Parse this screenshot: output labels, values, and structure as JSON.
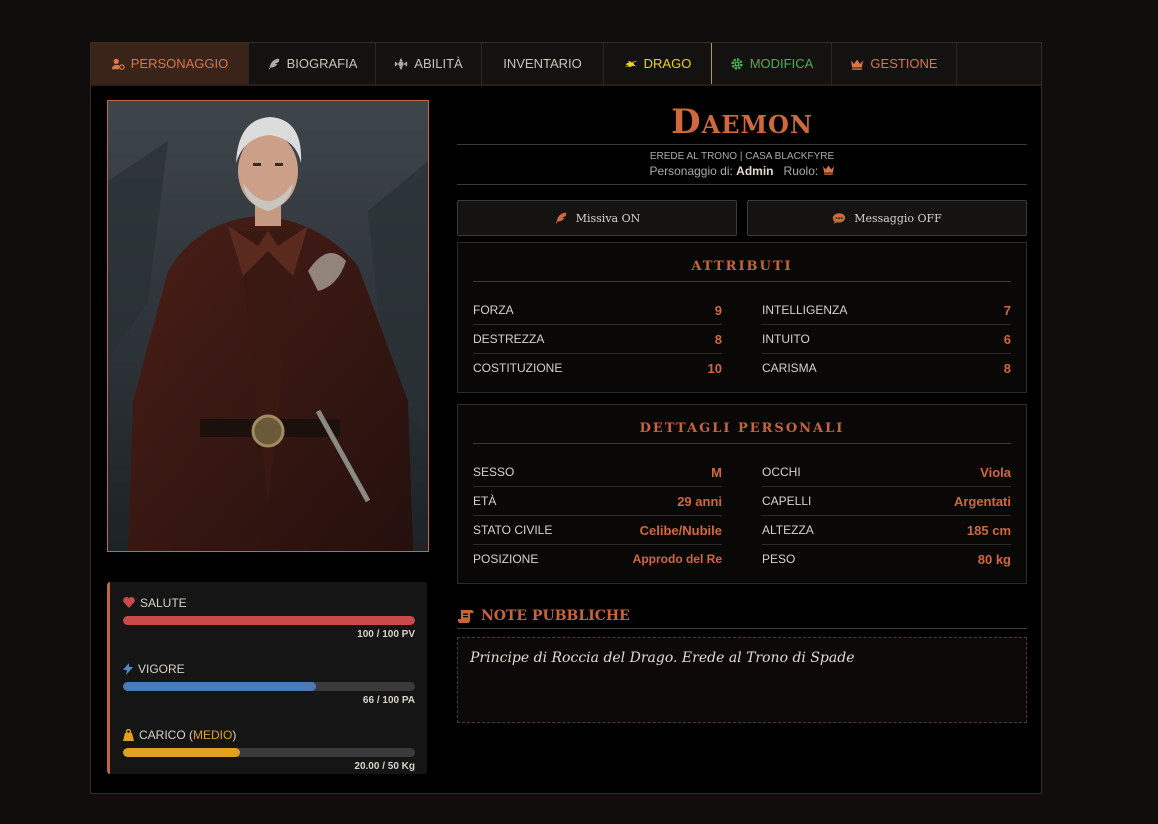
{
  "tabs": [
    {
      "label": "PERSONAGGIO",
      "icon": "user-gear-icon",
      "color": "#d7764a"
    },
    {
      "label": "BIOGRAFIA",
      "icon": "feather-icon",
      "color": "#c8c2b8"
    },
    {
      "label": "ABILITÀ",
      "icon": "emblem-icon",
      "color": "#c8c2b8"
    },
    {
      "label": "INVENTARIO",
      "icon": "",
      "color": "#c8c2b8"
    },
    {
      "label": "DRAGO",
      "icon": "dragon-icon",
      "color": "#f0d020"
    },
    {
      "label": "MODIFICA",
      "icon": "gear-icon",
      "color": "#4caf50"
    },
    {
      "label": "GESTIONE",
      "icon": "crown-icon",
      "color": "#d7764a"
    }
  ],
  "character": {
    "name": "Daemon",
    "subtitle": "Erede al Trono | Casa Blackfyre",
    "owner_label": "Personaggio di:",
    "owner": "Admin",
    "role_label": "Ruolo:",
    "role_icon": "crown-icon"
  },
  "actions": {
    "missiva": "Missiva ON",
    "messaggio": "Messaggio OFF"
  },
  "stats": {
    "salute": {
      "label": "SALUTE",
      "value": "100 / 100 PV",
      "fraction": 1.0,
      "color": "#c84a4a"
    },
    "vigore": {
      "label": "VIGORE",
      "value": "66 / 100 PA",
      "fraction": 0.66,
      "color": "#4a7ab8"
    },
    "carico": {
      "label_prefix": "CARICO (",
      "level": "MEDIO",
      "label_suffix": ")",
      "value": "20.00 / 50 Kg",
      "fraction": 0.4,
      "color": "#e0a020"
    }
  },
  "attributi": {
    "title": "ATTRIBUTI",
    "left": [
      {
        "k": "FORZA",
        "v": "9"
      },
      {
        "k": "DESTREZZA",
        "v": "8"
      },
      {
        "k": "COSTITUZIONE",
        "v": "10"
      }
    ],
    "right": [
      {
        "k": "INTELLIGENZA",
        "v": "7"
      },
      {
        "k": "INTUITO",
        "v": "6"
      },
      {
        "k": "CARISMA",
        "v": "8"
      }
    ]
  },
  "dettagli": {
    "title": "DETTAGLI PERSONALI",
    "left": [
      {
        "k": "SESSO",
        "v": "M"
      },
      {
        "k": "ETÀ",
        "v": "29 anni"
      },
      {
        "k": "STATO CIVILE",
        "v": "Celibe/Nubile"
      },
      {
        "k": "POSIZIONE",
        "v": "Approdo del Re"
      }
    ],
    "right": [
      {
        "k": "OCCHI",
        "v": "Viola"
      },
      {
        "k": "CAPELLI",
        "v": "Argentati"
      },
      {
        "k": "ALTEZZA",
        "v": "185 cm"
      },
      {
        "k": "PESO",
        "v": "80 kg"
      }
    ]
  },
  "notes": {
    "title": "NOTE PUBBLICHE",
    "text": "Principe di Roccia del Drago. Erede al Trono di Spade"
  }
}
